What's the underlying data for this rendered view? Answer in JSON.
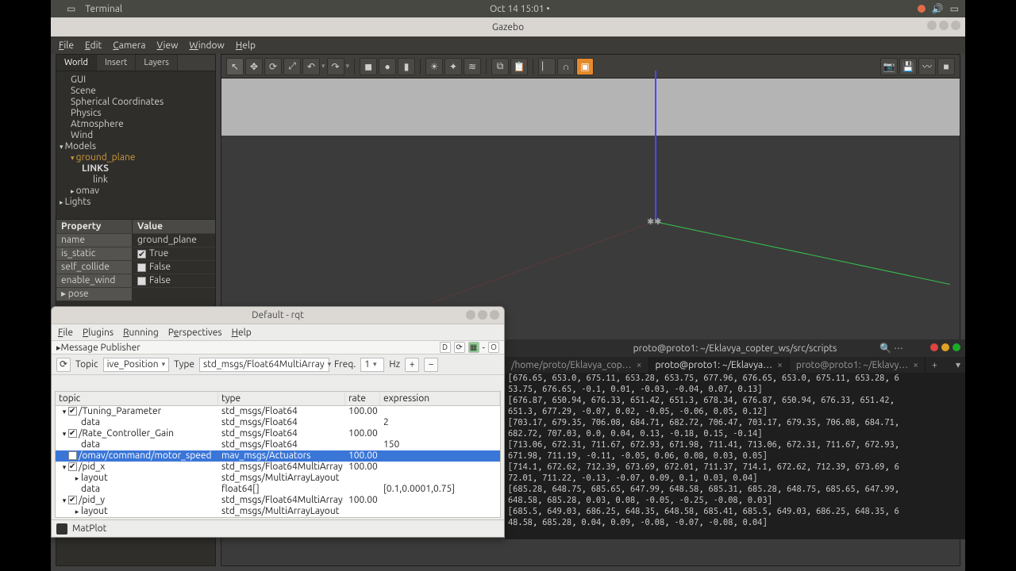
{
  "topbar": {
    "app": "Terminal",
    "clock": "Oct 14  15:01"
  },
  "gazebo": {
    "title": "Gazebo",
    "menu": [
      "File",
      "Edit",
      "Camera",
      "View",
      "Window",
      "Help"
    ],
    "tabs": [
      "World",
      "Insert",
      "Layers"
    ],
    "tree": {
      "gui": "GUI",
      "scene": "Scene",
      "spherical": "Spherical Coordinates",
      "physics": "Physics",
      "atmos": "Atmosphere",
      "wind": "Wind",
      "models": "Models",
      "ground": "ground_plane",
      "links": "LINKS",
      "link": "link",
      "omav": "omav",
      "lights": "Lights"
    },
    "prop": {
      "hdrK": "Property",
      "hdrV": "Value",
      "name_k": "name",
      "name_v": "ground_plane",
      "static_k": "is_static",
      "static_v": "True",
      "collide_k": "self_collide",
      "collide_v": "False",
      "wind_k": "enable_wind",
      "wind_v": "False",
      "pose_k": "pose"
    }
  },
  "rqt": {
    "title": "Default - rqt",
    "menu": [
      "File",
      "Plugins",
      "Running",
      "Perspectives",
      "Help"
    ],
    "panel": "Message Publisher",
    "ctrl": {
      "topicLbl": "Topic",
      "topicVal": "ive_Position",
      "typeLbl": "Type",
      "typeVal": "std_msgs/Float64MultiArray",
      "freqLbl": "Freq.",
      "freqVal": "1",
      "hzLbl": "Hz"
    },
    "cols": {
      "topic": "topic",
      "type": "type",
      "rate": "rate",
      "expr": "expression"
    },
    "rows": [
      {
        "lvl": 0,
        "caret": "▾",
        "chk": true,
        "topic": "/Tuning_Parameter",
        "type": "std_msgs/Float64",
        "rate": "100.00",
        "expr": ""
      },
      {
        "lvl": 1,
        "caret": "",
        "chk": null,
        "topic": "data",
        "type": "std_msgs/Float64",
        "rate": "",
        "expr": "2"
      },
      {
        "lvl": 0,
        "caret": "▾",
        "chk": true,
        "topic": "/Rate_Controller_Gain",
        "type": "std_msgs/Float64",
        "rate": "100.00",
        "expr": ""
      },
      {
        "lvl": 1,
        "caret": "",
        "chk": null,
        "topic": "data",
        "type": "std_msgs/Float64",
        "rate": "",
        "expr": "150"
      },
      {
        "lvl": 0,
        "caret": "",
        "chk": false,
        "topic": "/omav/command/motor_speed",
        "type": "mav_msgs/Actuators",
        "rate": "100.00",
        "expr": "",
        "sel": true
      },
      {
        "lvl": 0,
        "caret": "▾",
        "chk": true,
        "topic": "/pid_x",
        "type": "std_msgs/Float64MultiArray",
        "rate": "100.00",
        "expr": ""
      },
      {
        "lvl": 1,
        "caret": "▸",
        "chk": null,
        "topic": "layout",
        "type": "std_msgs/MultiArrayLayout",
        "rate": "",
        "expr": ""
      },
      {
        "lvl": 1,
        "caret": "",
        "chk": null,
        "topic": "data",
        "type": "float64[]",
        "rate": "",
        "expr": "[0.1,0.0001,0.75]"
      },
      {
        "lvl": 0,
        "caret": "▾",
        "chk": true,
        "topic": "/pid_y",
        "type": "std_msgs/Float64MultiArray",
        "rate": "100.00",
        "expr": ""
      },
      {
        "lvl": 1,
        "caret": "▸",
        "chk": null,
        "topic": "layout",
        "type": "std_msgs/MultiArrayLayout",
        "rate": "",
        "expr": ""
      }
    ],
    "status": "MatPlot"
  },
  "term": {
    "title": "proto@proto1: ~/Eklavya_copter_ws/src/scripts",
    "tabs": [
      "/home/proto/Eklavya_cop…",
      "proto@proto1: ~/Eklavya…",
      "proto@proto1: ~/Eklavy…"
    ],
    "lines": [
      "[676.65, 653.0, 675.11, 653.28, 653.75, 677.96, 676.65, 653.0, 675.11, 653.28, 6",
      "53.75, 676.65, -0.1, 0.01, -0.03, -0.04, 0.07, 0.13]",
      "[676.87, 650.94, 676.33, 651.42, 651.3, 678.34, 676.87, 650.94, 676.33, 651.42,",
      "651.3, 677.29, -0.07, 0.02, -0.05, -0.06, 0.05, 0.12]",
      "[703.17, 679.35, 706.08, 684.71, 682.72, 706.47, 703.17, 679.35, 706.08, 684.71,",
      "682.72, 707.03, 0.0, 0.04, 0.13, -0.18, 0.15, -0.14]",
      "[713.06, 672.31, 711.67, 672.93, 671.98, 711.41, 713.06, 672.31, 711.67, 672.93,",
      "671.98, 711.19, -0.11, -0.05, 0.06, 0.08, 0.03, 0.05]",
      "[714.1, 672.62, 712.39, 673.69, 672.01, 711.37, 714.1, 672.62, 712.39, 673.69, 6",
      "72.01, 711.22, -0.13, -0.07, 0.09, 0.1, 0.03, 0.04]",
      "[685.28, 648.75, 685.65, 647.99, 648.58, 685.31, 685.28, 648.75, 685.65, 647.99,",
      "648.58, 685.28, 0.03, 0.08, -0.05, -0.25, -0.08, 0.03]",
      "[685.5, 649.03, 686.25, 648.35, 648.58, 685.41, 685.5, 649.03, 686.25, 648.35, 6",
      "48.58, 685.28, 0.04, 0.09, -0.08, -0.07, -0.08, 0.04]"
    ]
  }
}
